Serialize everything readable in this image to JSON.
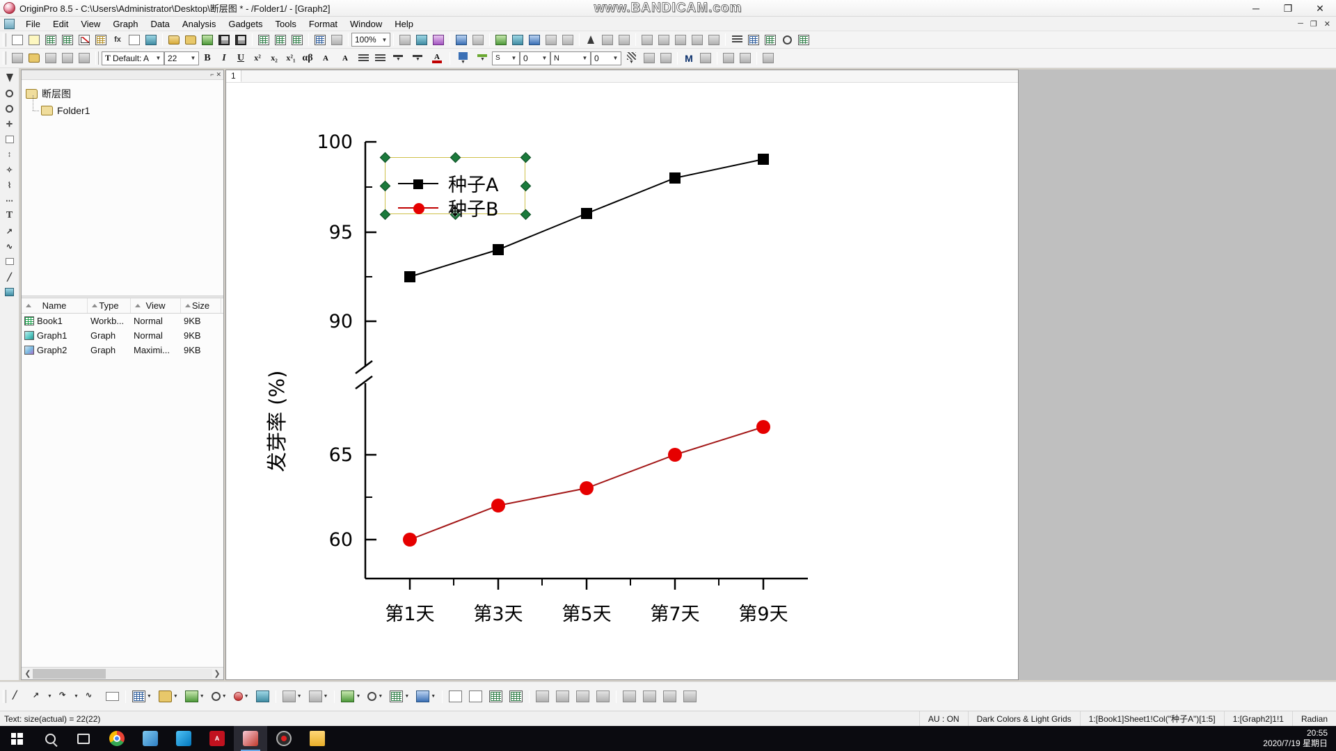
{
  "window": {
    "title": "OriginPro 8.5 - C:\\Users\\Administrator\\Desktop\\断层图 * - /Folder1/ - [Graph2]",
    "watermark": "www.BANDICAM.com",
    "minimize": "─",
    "maximize": "❐",
    "close": "✕",
    "doc_minimize": "─",
    "doc_restore": "❐",
    "doc_close": "✕"
  },
  "menu": {
    "items": [
      {
        "label": "File"
      },
      {
        "label": "Edit"
      },
      {
        "label": "View"
      },
      {
        "label": "Graph"
      },
      {
        "label": "Data"
      },
      {
        "label": "Analysis"
      },
      {
        "label": "Gadgets"
      },
      {
        "label": "Tools"
      },
      {
        "label": "Format"
      },
      {
        "label": "Window"
      },
      {
        "label": "Help"
      }
    ]
  },
  "toolbar_standard": {
    "zoom_value": "100%",
    "buttons": [
      {
        "name": "new-project",
        "icon": "document-icon"
      },
      {
        "name": "new-folder",
        "icon": "folder-document-icon"
      },
      {
        "name": "new-workbook",
        "icon": "workbook-icon"
      },
      {
        "name": "new-excel",
        "icon": "excel-icon"
      },
      {
        "name": "new-graph",
        "icon": "graph-icon"
      },
      {
        "name": "new-matrix",
        "icon": "matrix-icon"
      },
      {
        "name": "new-function-plot",
        "icon": "function-icon"
      },
      {
        "name": "new-layout",
        "icon": "layout-icon"
      },
      {
        "name": "new-notes",
        "icon": "notes-icon"
      },
      {
        "name": "open-project",
        "icon": "open-folder-icon"
      },
      {
        "name": "open-excel",
        "icon": "open-excel-icon"
      },
      {
        "name": "import-wizard",
        "icon": "import-icon"
      },
      {
        "name": "save-project",
        "icon": "save-icon"
      },
      {
        "name": "save-template",
        "icon": "save-template-icon"
      },
      {
        "name": "print",
        "icon": "print-icon"
      },
      {
        "name": "import-single-ascii",
        "icon": "import-ascii-icon"
      },
      {
        "name": "import-multiple-ascii",
        "icon": "import-multi-ascii-icon"
      },
      {
        "name": "duplicate",
        "icon": "duplicate-icon"
      },
      {
        "name": "run-script",
        "icon": "run-icon"
      },
      {
        "name": "refresh",
        "icon": "refresh-icon"
      },
      {
        "name": "layer-contents",
        "icon": "layer-icon"
      },
      {
        "name": "plot-setup",
        "icon": "plot-setup-icon"
      },
      {
        "name": "rescale",
        "icon": "rescale-icon"
      },
      {
        "name": "add-text",
        "icon": "text-tool-icon"
      },
      {
        "name": "data-reader",
        "icon": "data-reader-icon"
      },
      {
        "name": "screen-reader",
        "icon": "screen-reader-icon"
      },
      {
        "name": "data-selector",
        "icon": "data-selector-icon"
      },
      {
        "name": "zoom-in",
        "icon": "zoom-in-icon"
      },
      {
        "name": "merge-graph",
        "icon": "merge-graph-icon"
      },
      {
        "name": "extract-layers",
        "icon": "extract-icon"
      },
      {
        "name": "new-layer",
        "icon": "new-layer-icon"
      },
      {
        "name": "speed-mode",
        "icon": "speed-mode-icon"
      },
      {
        "name": "arrange-layers",
        "icon": "arrange-icon"
      },
      {
        "name": "exchange-axis",
        "icon": "exchange-axis-icon"
      },
      {
        "name": "align-left",
        "icon": "align-left-icon"
      },
      {
        "name": "align-center",
        "icon": "align-center-icon"
      },
      {
        "name": "align-right",
        "icon": "align-right-icon"
      },
      {
        "name": "clock",
        "icon": "clock-icon"
      },
      {
        "name": "grid",
        "icon": "grid-icon"
      }
    ]
  },
  "toolbar_format": {
    "font_value": "Default: A",
    "size_value": "22",
    "bold": "B",
    "italic": "I",
    "underline": "U",
    "superscript": "x²",
    "subscript": "x₂",
    "supsub": "x²₁",
    "greek": "αβ",
    "increase_font": "A",
    "decrease_font": "A",
    "line_width_value": "0",
    "line_style_label": "S",
    "pattern_value": "0",
    "pattern_label": "N",
    "buttons": [
      {
        "name": "pointer",
        "icon": "pointer-icon"
      },
      {
        "name": "fill-color",
        "icon": "fill-color-icon"
      },
      {
        "name": "mask-tool",
        "icon": "mask-icon"
      },
      {
        "name": "lock-tool",
        "icon": "lock-icon"
      },
      {
        "name": "brush-tool",
        "icon": "brush-icon"
      },
      {
        "name": "align-text",
        "icon": "align-text-icon"
      },
      {
        "name": "line-style",
        "icon": "line-style-icon"
      },
      {
        "name": "font-color",
        "icon": "font-color-icon"
      },
      {
        "name": "line-color",
        "icon": "line-color-icon"
      },
      {
        "name": "pattern-color",
        "icon": "pattern-color-icon"
      },
      {
        "name": "fill-pattern",
        "icon": "fill-pattern-icon"
      },
      {
        "name": "merge",
        "icon": "merge-icon"
      },
      {
        "name": "split",
        "icon": "split-icon"
      },
      {
        "name": "group",
        "icon": "group-icon"
      },
      {
        "name": "ungroup",
        "icon": "ungroup-icon"
      },
      {
        "name": "lock-layer",
        "icon": "lock-layer-icon"
      }
    ]
  },
  "left_tools": [
    {
      "name": "pointer-tool",
      "icon": "arrow-icon"
    },
    {
      "name": "zoom-tool",
      "icon": "magnifier-icon"
    },
    {
      "name": "zoom-out-tool",
      "icon": "magnifier-minus-icon"
    },
    {
      "name": "move-tool",
      "icon": "move-icon"
    },
    {
      "name": "region-tool",
      "icon": "region-icon"
    },
    {
      "name": "scale-tool",
      "icon": "scale-icon"
    },
    {
      "name": "wizard-tool",
      "icon": "wand-icon"
    },
    {
      "name": "data-tool",
      "icon": "data-icon"
    },
    {
      "name": "text-tool",
      "icon": "text-icon"
    },
    {
      "name": "arrow-tool",
      "icon": "arrow-draw-icon"
    },
    {
      "name": "curve-tool",
      "icon": "curve-icon"
    },
    {
      "name": "rect-tool",
      "icon": "rectangle-icon"
    },
    {
      "name": "line-tool",
      "icon": "line-icon"
    },
    {
      "name": "region-select-tool",
      "icon": "region-select-icon"
    },
    {
      "name": "screen-tool",
      "icon": "screen-icon"
    }
  ],
  "explorer": {
    "tree": {
      "root": "断层图",
      "child": "Folder1"
    },
    "columns": [
      "Name",
      "Type",
      "View",
      "Size"
    ],
    "rows": [
      {
        "icon": "workbook-icon",
        "name": "Book1",
        "type": "Workb...",
        "view": "Normal",
        "size": "9KB"
      },
      {
        "icon": "graph-icon",
        "name": "Graph1",
        "type": "Graph",
        "view": "Normal",
        "size": "9KB"
      },
      {
        "icon": "graph-icon",
        "name": "Graph2",
        "type": "Graph",
        "view": "Maximi...",
        "size": "9KB"
      }
    ]
  },
  "graph_window": {
    "tab_label": "1"
  },
  "chart_data": {
    "type": "line",
    "title": "",
    "xlabel": "",
    "ylabel": "发芽率 (%)",
    "categories": [
      "第1天",
      "第3天",
      "第5天",
      "第7天",
      "第9天"
    ],
    "series": [
      {
        "name": "种子A",
        "values": [
          92,
          93,
          95,
          97,
          98
        ],
        "color": "#000000",
        "marker": "square"
      },
      {
        "name": "种子B",
        "values": [
          60,
          62,
          63,
          65,
          66.6
        ],
        "color": "#e60000",
        "marker": "circle"
      }
    ],
    "y_ticks": [
      "100",
      "95",
      "90",
      "65",
      "60"
    ],
    "axis_break": true,
    "ylim": [
      58.5,
      100
    ],
    "grid": false,
    "legend_position": "top-left",
    "legend_selected": true
  },
  "bottom_toolbar": [
    {
      "name": "line-tool",
      "icon": "line-icon"
    },
    {
      "name": "arrow-tool",
      "icon": "arrow-icon"
    },
    {
      "name": "curve-arrow-tool",
      "icon": "curve-arrow-icon"
    },
    {
      "name": "freehand-tool",
      "icon": "freehand-icon"
    },
    {
      "name": "rectangle-tool",
      "icon": "rectangle-icon"
    },
    {
      "name": "polygon-tool",
      "icon": "polygon-icon"
    },
    {
      "name": "region-tool",
      "icon": "region-icon"
    },
    {
      "name": "color-tool",
      "icon": "color-icon"
    },
    {
      "name": "settings-tool",
      "icon": "settings-icon"
    },
    {
      "name": "marker-tool",
      "icon": "marker-icon"
    },
    {
      "name": "image-tool",
      "icon": "image-icon"
    },
    {
      "name": "layer1-tool",
      "icon": "layer-icon"
    },
    {
      "name": "layer2-tool",
      "icon": "layers-icon"
    },
    {
      "name": "link-tool",
      "icon": "link-icon"
    },
    {
      "name": "pie-tool",
      "icon": "pie-icon"
    },
    {
      "name": "bar-tool",
      "icon": "bar-icon"
    },
    {
      "name": "chart-tool",
      "icon": "chart-icon"
    },
    {
      "name": "copy-page-tool",
      "icon": "copy-page-icon"
    },
    {
      "name": "paste-page-tool",
      "icon": "paste-page-icon"
    },
    {
      "name": "grid1-tool",
      "icon": "grid-icon"
    },
    {
      "name": "grid2-tool",
      "icon": "grid-alt-icon"
    },
    {
      "name": "align1-tool",
      "icon": "align-icon"
    },
    {
      "name": "align2-tool",
      "icon": "align-alt-icon"
    },
    {
      "name": "size1-tool",
      "icon": "size-icon"
    },
    {
      "name": "size2-tool",
      "icon": "size-alt-icon"
    },
    {
      "name": "export-tool",
      "icon": "export-icon"
    },
    {
      "name": "frame-tool",
      "icon": "frame-icon"
    },
    {
      "name": "box-tool",
      "icon": "box-icon"
    },
    {
      "name": "stack-tool",
      "icon": "stack-icon"
    }
  ],
  "statusbar": {
    "left": "Text: size(actual) = 22(22)",
    "segments": [
      "AU : ON",
      "Dark Colors & Light Grids",
      "1:[Book1]Sheet1!Col(\"种子A\")[1:5]",
      "1:[Graph2]1!1",
      "Radian"
    ]
  },
  "taskbar": {
    "items": [
      {
        "name": "start-button",
        "icon": "windows-icon"
      },
      {
        "name": "search-button",
        "icon": "search-icon"
      },
      {
        "name": "task-view-button",
        "icon": "task-view-icon"
      },
      {
        "name": "chrome-app",
        "icon": "chrome-icon"
      },
      {
        "name": "bird-app",
        "icon": "bird-icon"
      },
      {
        "name": "media-app",
        "icon": "media-icon"
      },
      {
        "name": "acrobat-app",
        "icon": "pdf-icon"
      },
      {
        "name": "origin-app",
        "icon": "origin-icon"
      },
      {
        "name": "bandicam-app",
        "icon": "record-icon"
      },
      {
        "name": "explorer-app",
        "icon": "folder-icon"
      }
    ],
    "time": "20:55",
    "date": "2020/7/19 星期日"
  }
}
